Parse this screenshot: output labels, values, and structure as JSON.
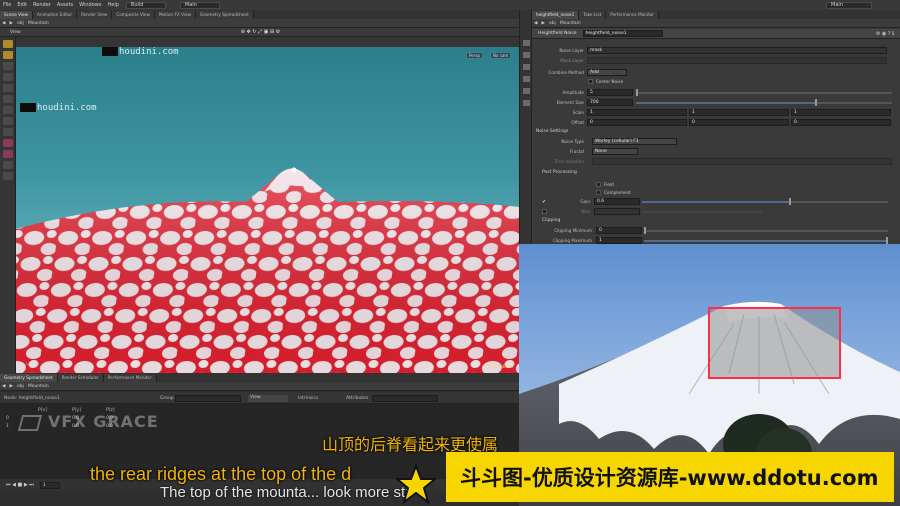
{
  "menubar": {
    "items": [
      "File",
      "Edit",
      "Render",
      "Assets",
      "Windows",
      "Help"
    ],
    "build_label": "Build",
    "main_label": "Main",
    "right_main_label": "Main"
  },
  "viewer_tabs": [
    "Scene View",
    "Animation Editor",
    "Render View",
    "Composite View",
    "Motion FX View",
    "Geometry Spreadsheet"
  ],
  "viewer_path": {
    "root": "obj",
    "node": "Mountain"
  },
  "view_label": "View",
  "viewport": {
    "watermark": "houdini.com",
    "persp_btn": "Persp",
    "cam_btn": "No cam",
    "edition_label": "Indie Edition"
  },
  "param_tabs": [
    "heightfield_noise1",
    "Take List",
    "Performance Monitor"
  ],
  "param_path": {
    "root": "obj",
    "node": "Mountain"
  },
  "node": {
    "type": "Heightfield Noise",
    "name": "heightfield_noise1"
  },
  "params": {
    "noise_layer": {
      "label": "Noise Layer",
      "value": "mask"
    },
    "mask_layer": {
      "label": "Mask Layer"
    },
    "combine": {
      "label": "Combine Method",
      "value": "Add"
    },
    "center_noise": "Center Noise",
    "amplitude": {
      "label": "Amplitude",
      "value": "5"
    },
    "element_size": {
      "label": "Element Size",
      "value": "700"
    },
    "scale": {
      "label": "Scale",
      "values": [
        "1",
        "1",
        "1"
      ]
    },
    "offset": {
      "label": "Offset",
      "values": [
        "0",
        "0",
        "0"
      ]
    },
    "noise_settings": "Noise Settings",
    "noise_type": {
      "label": "Noise Type",
      "value": "Worley (cellular) F1"
    },
    "fractal": {
      "label": "Fractal",
      "value": "None"
    },
    "time": {
      "label": "Time Variation"
    },
    "post_processing": "Post Processing",
    "field": "Field",
    "complement": "Complement",
    "gain": {
      "label": "Gain",
      "value": "0.6"
    },
    "bias": {
      "label": "Bias"
    },
    "clipping": "Clipping",
    "clip_min": {
      "label": "Clipping Minimum",
      "value": "0"
    },
    "clip_max": {
      "label": "Clipping Maximum",
      "value": "1"
    }
  },
  "bottom_tabs": [
    "Geometry Spreadsheet",
    "Render Scheduler",
    "Performance Monitor"
  ],
  "bottom_path": {
    "root": "obj",
    "node": "Mountain"
  },
  "spreadsheet": {
    "node_label": "Node: heightfield_noise1",
    "group_label": "Group",
    "view_label": "View",
    "intrinsics_label": "Intrinsics",
    "attributes_label": "Attributes",
    "columns": [
      "P[x]",
      "P[y]",
      "P[z]"
    ],
    "row0": [
      "0",
      "0.0",
      "0.0"
    ],
    "row1": [
      "1",
      "0.0",
      "0.0"
    ]
  },
  "timeline_frame": "1",
  "overlay": {
    "logo_text": "VFX GRACE",
    "subtitle_cn": "山顶的后脊看起来更使属",
    "subtitle_en": "the rear ridges at the top of the d",
    "subtitle_en2": "The top of the mounta... look more str",
    "banner_text": "斗斗图-优质设计资源库-www.ddotu.com"
  },
  "colors": {
    "accent": "#f7d600",
    "subtitle": "#f0b300",
    "mask": "#e02030"
  }
}
